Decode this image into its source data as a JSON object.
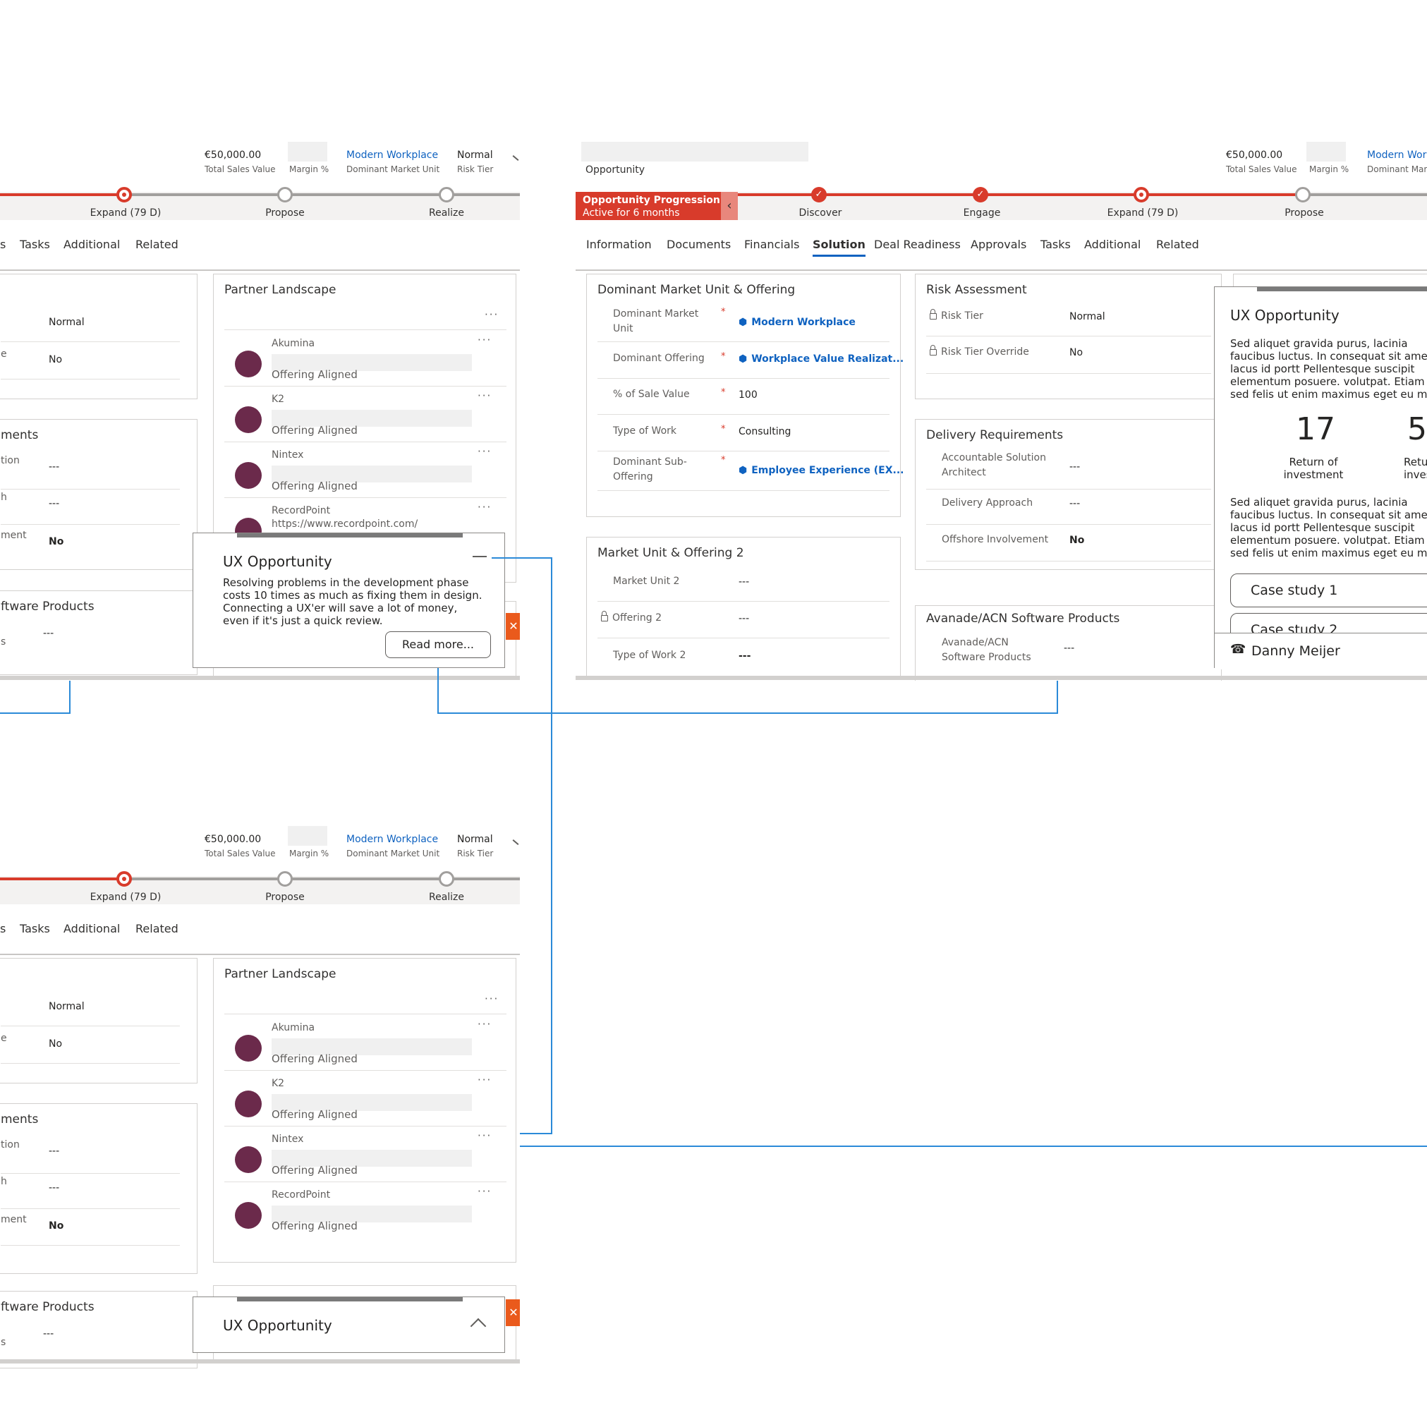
{
  "header": {
    "total_sales_value": "€50,000.00",
    "total_sales_value_label": "Total Sales Value",
    "margin_label": "Margin %",
    "dominant_market_unit": "Modern Workplace",
    "dominant_market_unit_label": "Dominant Market Unit",
    "risk_tier": "Normal",
    "risk_tier_label": "Risk Tier",
    "record_type": "Opportunity",
    "modern_workplace_cut": "Modern Wor",
    "dominant_market_unit_cut": "Dominant Mark"
  },
  "process": {
    "title": "Opportunity Progression",
    "subtitle": "Active for 6 months",
    "stages": [
      "Discover",
      "Engage",
      "Expand  (79 D)",
      "Propose",
      "Realize"
    ]
  },
  "tabs": {
    "full": [
      "Information",
      "Documents",
      "Financials",
      "Solution",
      "Deal Readiness",
      "Approvals",
      "Tasks",
      "Additional",
      "Related"
    ],
    "selected": "Solution",
    "cut_prefix": "s"
  },
  "cards": {
    "dominant": {
      "title": "Dominant Market Unit & Offering",
      "fields": [
        {
          "label": "Dominant Market Unit",
          "value": "Modern Workplace"
        },
        {
          "label": "Dominant Offering",
          "value": "Workplace Value Realizat..."
        },
        {
          "label": "% of Sale Value",
          "value": "100"
        },
        {
          "label": "Type of Work",
          "value": "Consulting"
        },
        {
          "label": "Dominant Sub-Offering",
          "value": "Employee Experience (EX..."
        }
      ]
    },
    "mu2": {
      "title": "Market Unit & Offering 2",
      "fields": [
        {
          "label": "Market Unit 2",
          "value": "---"
        },
        {
          "label": "Offering 2",
          "value": "---"
        },
        {
          "label": "Type of Work 2",
          "value": "---"
        }
      ]
    },
    "risk": {
      "title": "Risk Assessment",
      "fields": [
        {
          "label": "Risk Tier",
          "value": "Normal"
        },
        {
          "label": "Risk Tier Override",
          "value": "No"
        }
      ]
    },
    "delivery": {
      "title": "Delivery Requirements",
      "title_cut": "ments",
      "fields": [
        {
          "label": "Accountable Solution Architect",
          "value": "---"
        },
        {
          "label": "Delivery Approach",
          "value": "---"
        },
        {
          "label": "Offshore Involvement",
          "value": "No"
        }
      ],
      "cut_labels": [
        "tion",
        "h",
        "ment"
      ]
    },
    "software": {
      "title": "Avanade/ACN Software Products",
      "title_cut": "ftware Products",
      "field_label": "Avanade/ACN Software Products",
      "field_cut": "s",
      "field_value": "---"
    },
    "risk_cut": {
      "label": "e",
      "normal": "Normal",
      "no": "No"
    },
    "partner": {
      "title": "Partner Landscape",
      "partners": [
        {
          "name": "Akumina",
          "status": "Offering Aligned"
        },
        {
          "name": "K2",
          "status": "Offering Aligned"
        },
        {
          "name": "Nintex",
          "status": "Offering Aligned"
        },
        {
          "name": "RecordPoint",
          "status": "Offering Aligned"
        }
      ],
      "recordpoint_url": "https://www.recordpoint.com/"
    }
  },
  "ux_popup": {
    "title": "UX Opportunity",
    "text": "Resolving problems in the development phase costs 10 times as much as fixing them in design. Connecting a UX'er will save a lot of money, even if it's just a quick review.",
    "button": "Read more...",
    "collapse_icon": "minus-icon"
  },
  "ux_panel": {
    "title": "UX Opportunity",
    "paragraph": "Sed aliquet gravida purus, lacinia faucibus luctus. In consequat sit amet lacus id portt Pellentesque suscipit elementum posuere. volutpat. Etiam sed felis ut enim maximus eget eu mi. In imperdiet porta nibh et mo",
    "stat1_value": "17",
    "stat1_label": "Return of investment",
    "stat2_value": "5",
    "stat2_label": "Retu inves",
    "buttons": [
      "Case study 1",
      "Case study 2"
    ],
    "contact": "Danny Meijer",
    "contact_icon": "phone-icon"
  },
  "ux_collapsed": {
    "title": "UX Opportunity",
    "icon": "chevron-up-icon"
  },
  "colors": {
    "accent": "#d83b2b",
    "link": "#0f62c0",
    "connector": "#2b8ad8",
    "avatar": "#6b2a4b",
    "close": "#ea5a1c"
  }
}
